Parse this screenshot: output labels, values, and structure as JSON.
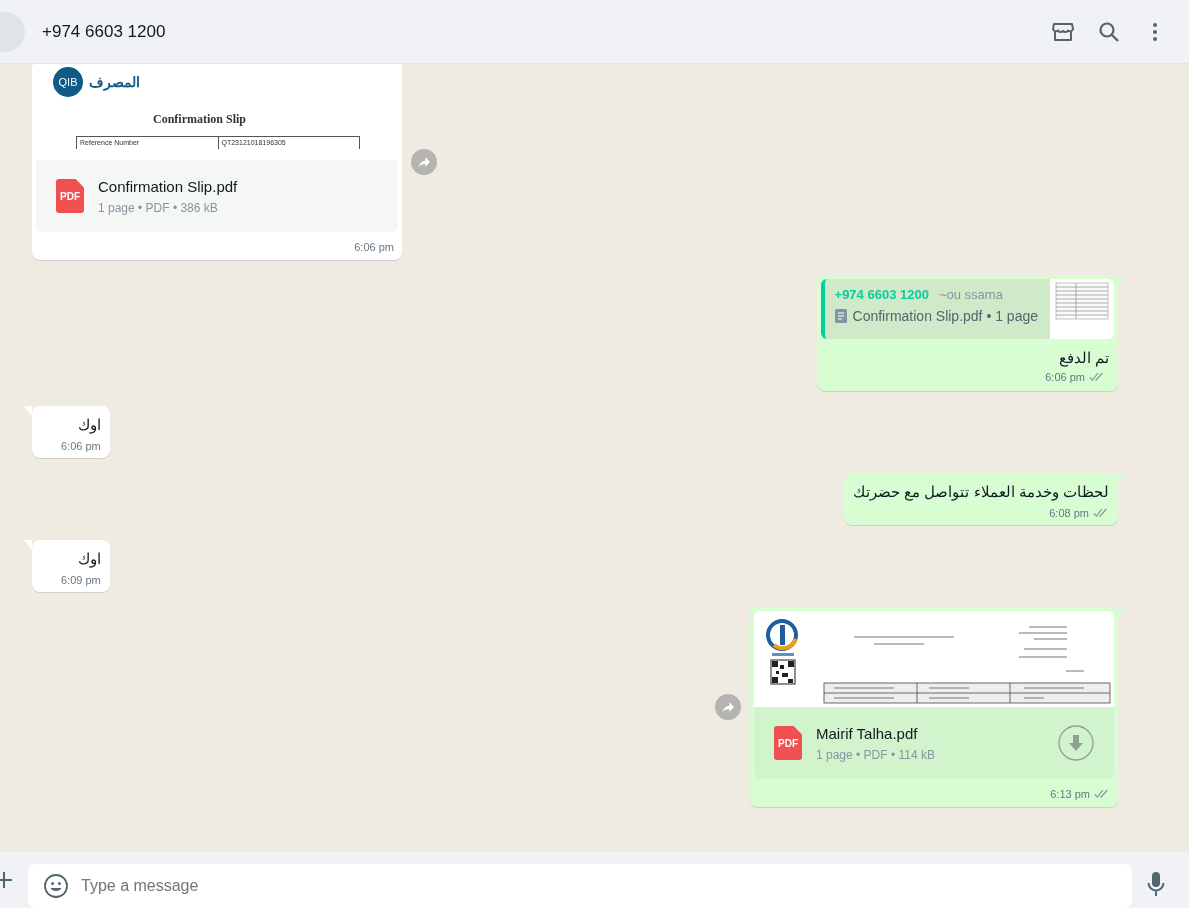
{
  "header": {
    "contact": "+974 6603 1200"
  },
  "messages": [
    {
      "kind": "document",
      "outgoing": false,
      "forward": true,
      "preview": {
        "kind": "bank-slip",
        "logo": "QIB",
        "bank_name": "المصرف",
        "title": "Confirmation Slip",
        "rows": [
          [
            "Reference Number",
            "QT23121018196305"
          ]
        ]
      },
      "file_icon": "PDF",
      "file_name": "Confirmation Slip.pdf",
      "meta": "1 page • PDF • 386 kB",
      "downloaded": true,
      "time": "6:06 pm"
    },
    {
      "kind": "reply",
      "outgoing": true,
      "quote": {
        "sender": "+974 6603 1200",
        "sender_name": "~ou ssama",
        "text": "Confirmation Slip.pdf • 1 page"
      },
      "text": "تم الدفع",
      "time": "6:06 pm",
      "read": false
    },
    {
      "kind": "text",
      "outgoing": false,
      "text": "اوك",
      "time": "6:06 pm"
    },
    {
      "kind": "text",
      "outgoing": true,
      "text": "لحظات وخدمة العملاء تتواصل مع حضرتك",
      "time": "6:08 pm",
      "read": false
    },
    {
      "kind": "text",
      "outgoing": false,
      "text": "اوك",
      "time": "6:09 pm"
    },
    {
      "kind": "document",
      "outgoing": true,
      "forward": true,
      "preview": {
        "kind": "invoice"
      },
      "file_icon": "PDF",
      "file_name": "Mairif Talha.pdf",
      "meta": "1 page • PDF • 114 kB",
      "downloaded": false,
      "time": "6:13 pm",
      "read": false
    }
  ],
  "composer": {
    "placeholder": "Type a message"
  }
}
